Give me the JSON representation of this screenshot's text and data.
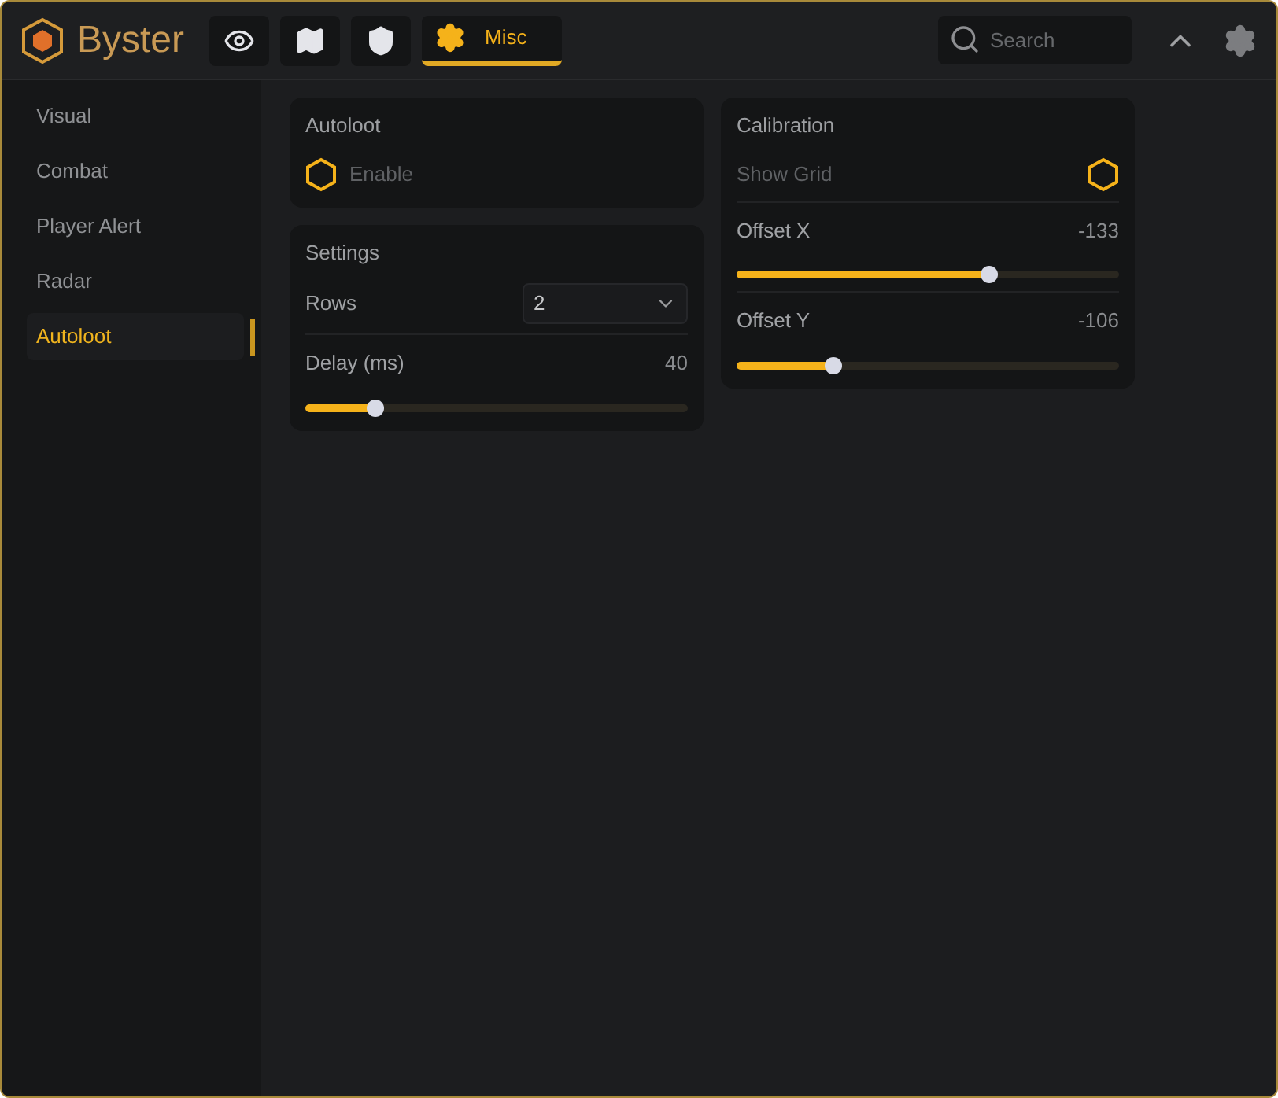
{
  "app": {
    "name": "Byster"
  },
  "tabs": [
    {
      "selected": false
    },
    {
      "selected": false
    },
    {
      "selected": false
    },
    {
      "label": "Misc",
      "selected": true
    }
  ],
  "search": {
    "placeholder": "Search"
  },
  "sidebar": {
    "items": [
      {
        "label": "Visual",
        "selected": false
      },
      {
        "label": "Combat",
        "selected": false
      },
      {
        "label": "Player Alert",
        "selected": false
      },
      {
        "label": "Radar",
        "selected": false
      },
      {
        "label": "Autoloot",
        "selected": true
      }
    ]
  },
  "columns": [
    [
      {
        "title": "Autoloot",
        "rows": [
          {
            "kind": "checkbox",
            "label": "Enable",
            "checked": false
          }
        ]
      },
      {
        "title": "Settings",
        "rows": [
          {
            "kind": "select",
            "label": "Rows",
            "value": "2"
          },
          {
            "kind": "slider",
            "label": "Delay (ms)",
            "reading": "40",
            "level": 0.18
          }
        ]
      }
    ],
    [
      {
        "title": "Calibration",
        "rows": [
          {
            "kind": "trailingcheckbox",
            "label": "Show Grid",
            "checked": false
          },
          {
            "kind": "slider",
            "label": "Offset X",
            "reading": "-133",
            "level": 0.66
          },
          {
            "kind": "slider",
            "label": "Offset Y",
            "reading": "-106",
            "level": 0.25
          }
        ]
      }
    ]
  ]
}
